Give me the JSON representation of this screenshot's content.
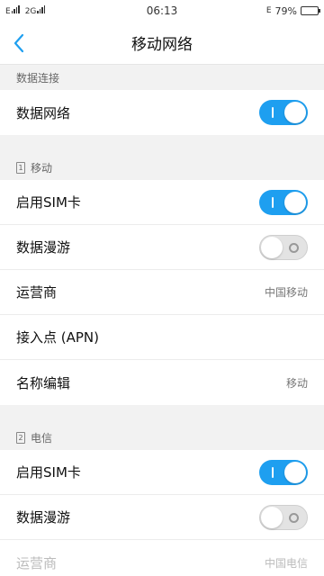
{
  "status_bar": {
    "left": "E",
    "network_2g": "2G",
    "time": "06:13",
    "battery_percent": "79%",
    "battery_level": 0.79
  },
  "header": {
    "title": "移动网络"
  },
  "data_section": {
    "header": "数据连接",
    "items": [
      {
        "label": "数据网络",
        "toggle": "on"
      }
    ]
  },
  "sim1": {
    "index": "1",
    "header": "移动",
    "items": [
      {
        "label": "启用SIM卡",
        "toggle": "on"
      },
      {
        "label": "数据漫游",
        "toggle": "off"
      },
      {
        "label": "运营商",
        "value": "中国移动"
      },
      {
        "label": "接入点 (APN)"
      },
      {
        "label": "名称编辑",
        "value": "移动"
      }
    ]
  },
  "sim2": {
    "index": "2",
    "header": "电信",
    "items": [
      {
        "label": "启用SIM卡",
        "toggle": "on"
      },
      {
        "label": "数据漫游",
        "toggle": "off"
      },
      {
        "label": "运营商",
        "value": "中国电信"
      }
    ]
  },
  "colors": {
    "accent": "#1e9ff0",
    "background": "#f2f2f2"
  },
  "icons": [
    "back-arrow-icon",
    "signal-icon",
    "battery-icon",
    "sim-card-icon"
  ]
}
